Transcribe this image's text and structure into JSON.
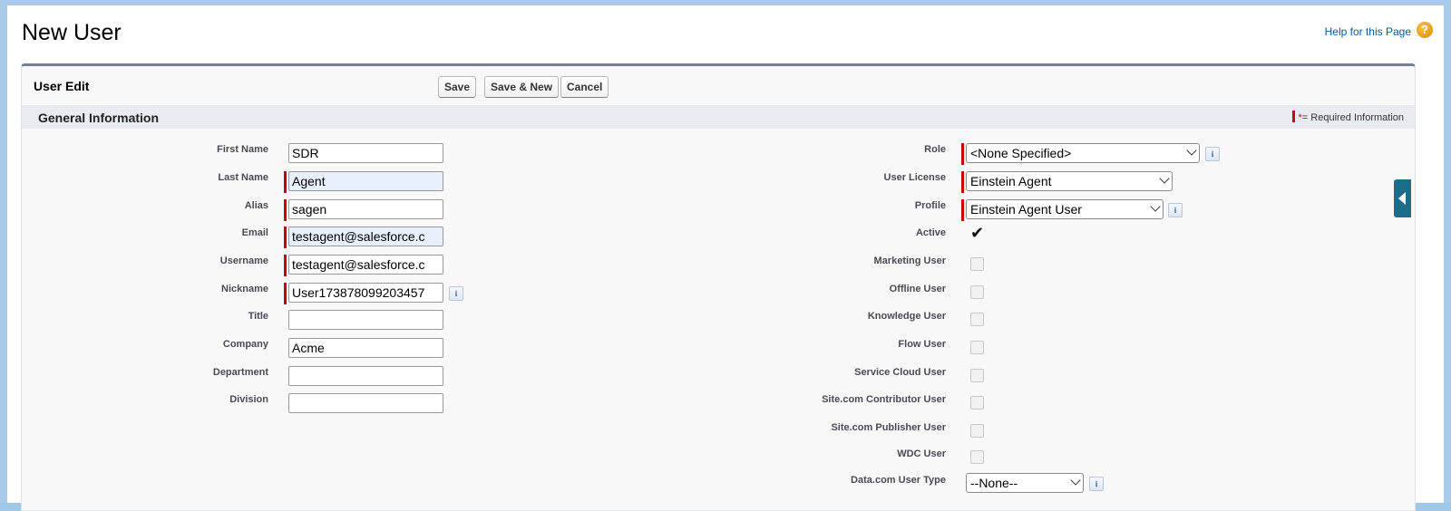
{
  "page": {
    "title": "New User",
    "help_link": "Help for this Page",
    "help_icon": "?"
  },
  "toolbar": {
    "section_title": "User Edit",
    "save_label": "Save",
    "save_new_label": "Save & New",
    "cancel_label": "Cancel"
  },
  "general": {
    "title": "General Information",
    "required_legend_star": "*",
    "required_legend_text": "= Required Information"
  },
  "left_fields": {
    "first_name": {
      "label": "First Name",
      "value": "SDR"
    },
    "last_name": {
      "label": "Last Name",
      "value": "Agent"
    },
    "alias": {
      "label": "Alias",
      "value": "sagen"
    },
    "email": {
      "label": "Email",
      "value": "testagent@salesforce.c"
    },
    "username": {
      "label": "Username",
      "value": "testagent@salesforce.c"
    },
    "nickname": {
      "label": "Nickname",
      "value": "User173878099203457"
    },
    "title": {
      "label": "Title",
      "value": ""
    },
    "company": {
      "label": "Company",
      "value": "Acme"
    },
    "department": {
      "label": "Department",
      "value": ""
    },
    "division": {
      "label": "Division",
      "value": ""
    }
  },
  "right_fields": {
    "role": {
      "label": "Role",
      "value": "<None Specified>"
    },
    "user_license": {
      "label": "User License",
      "value": "Einstein Agent"
    },
    "profile": {
      "label": "Profile",
      "value": "Einstein Agent User"
    },
    "active": {
      "label": "Active",
      "checked": true,
      "mark": "✔"
    },
    "marketing_user": {
      "label": "Marketing User",
      "checked": false
    },
    "offline_user": {
      "label": "Offline User",
      "checked": false
    },
    "knowledge_user": {
      "label": "Knowledge User",
      "checked": false
    },
    "flow_user": {
      "label": "Flow User",
      "checked": false
    },
    "service_cloud_user": {
      "label": "Service Cloud User",
      "checked": false
    },
    "sitecom_contributor_user": {
      "label": "Site.com Contributor User",
      "checked": false
    },
    "sitecom_publisher_user": {
      "label": "Site.com Publisher User",
      "checked": false
    },
    "wdc_user": {
      "label": "WDC User",
      "checked": false
    },
    "datacom_user_type": {
      "label": "Data.com User Type",
      "value": "--None--"
    }
  },
  "info_icon_glyph": "i",
  "colors": {
    "required": "#cc0000",
    "link": "#015ba7",
    "panel_border": "#747e96",
    "side_tab": "#1d6d8a"
  }
}
